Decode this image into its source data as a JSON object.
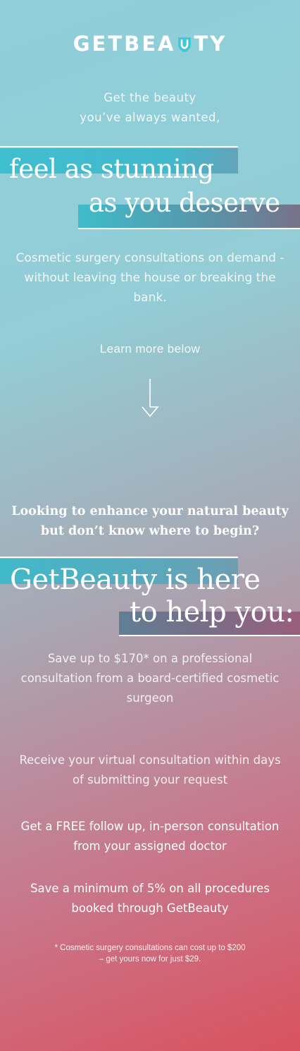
{
  "logo": {
    "prefix": "GETBEA",
    "suffix": "TY",
    "icon": "shield-u-icon"
  },
  "hero": {
    "intro_line1": "Get the beauty",
    "intro_line2": "you’ve always wanted,",
    "headline_line1": "feel as stunning",
    "headline_line2": "as you deserve",
    "description": "Cosmetic surgery consultations on demand - without leaving the house or breaking the bank.",
    "learn_more": "Learn more below",
    "arrow_icon": "down-arrow-icon"
  },
  "section2": {
    "question_line1": "Looking to enhance your natural beauty",
    "question_line2": "but don’t know where to begin?",
    "headline_line1": "GetBeauty is here",
    "headline_line2": "to help you:"
  },
  "benefits": [
    "Save up to $170* on a professional consultation from a board-certified cosmetic surgeon",
    "Receive your virtual consultation within days of submitting your request",
    "Get a FREE follow up, in-person consultation from your assigned doctor",
    "Save a minimum of 5% on all procedures booked through GetBeauty"
  ],
  "footnote_line1": "* Cosmetic surgery consultations can cost up to $200",
  "footnote_line2": "– get yours now for just $29.",
  "colors": {
    "teal": "#3fbfd0",
    "gradient_top": "#8ecfda",
    "gradient_bottom": "#d9525f"
  }
}
